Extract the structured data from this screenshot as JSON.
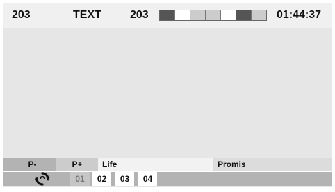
{
  "header": {
    "page_left": "203",
    "mode": "TEXT",
    "page_current": "203",
    "time": "01:44:37",
    "colorbar": [
      "#555555",
      "#ffffff",
      "#cccccc",
      "#cccccc",
      "#ffffff",
      "#555555",
      "#cccccc"
    ]
  },
  "buttons": {
    "prev_label": "P-",
    "next_label": "P+",
    "life_label": "Life",
    "promis_label": "Promis"
  },
  "subpages": {
    "icon": "rotate-arrows-icon",
    "items": [
      "01",
      "02",
      "03",
      "04"
    ],
    "current": "01"
  },
  "colors": {
    "background": "#e6e6e6",
    "header": "#f0f0f0",
    "button_dark": "#b3b3b3",
    "button_light": "#f2f2f2"
  }
}
